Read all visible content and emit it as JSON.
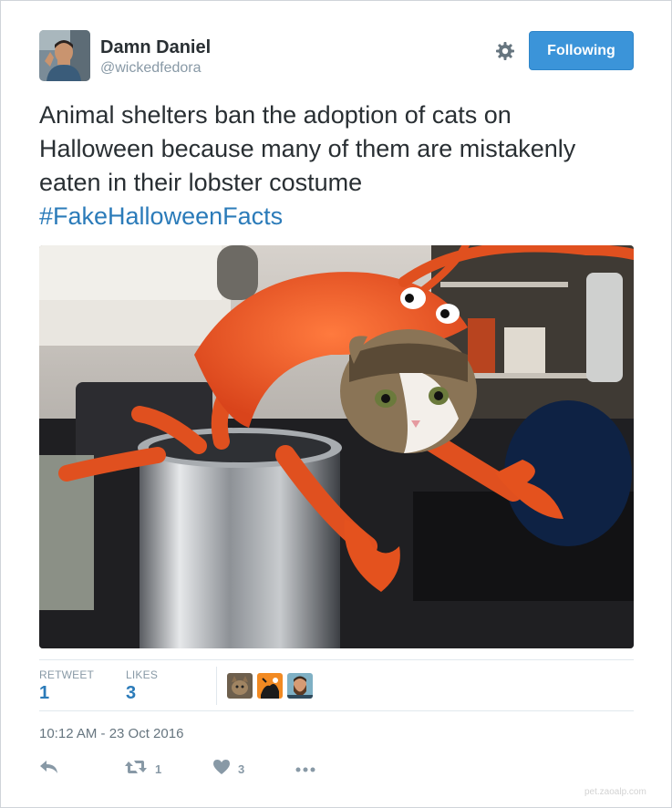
{
  "author": {
    "display_name": "Damn Daniel",
    "handle": "@wickedfedora"
  },
  "header": {
    "settings_icon": "gear-icon",
    "follow_label": "Following"
  },
  "tweet": {
    "text_lines": [
      "Animal shelters ban the adoption of cats on",
      "Halloween because many of them are mistakenly",
      "eaten in their lobster costume"
    ],
    "hashtag": "#FakeHalloweenFacts"
  },
  "stats": {
    "retweet_label": "RETWEET",
    "retweet_count": "1",
    "likes_label": "LIKES",
    "likes_count": "3"
  },
  "timestamp": "10:12 AM - 23 Oct 2016",
  "actions": {
    "reply_icon": "reply-icon",
    "retweet_icon": "retweet-icon",
    "retweet_count": "1",
    "like_icon": "heart-icon",
    "like_count": "3",
    "more_icon": "more-icon"
  },
  "watermark": "pet.zaoalp.com",
  "colors": {
    "follow_button": "#3b94d9",
    "link": "#2b7bb9",
    "muted": "#8899a6"
  }
}
